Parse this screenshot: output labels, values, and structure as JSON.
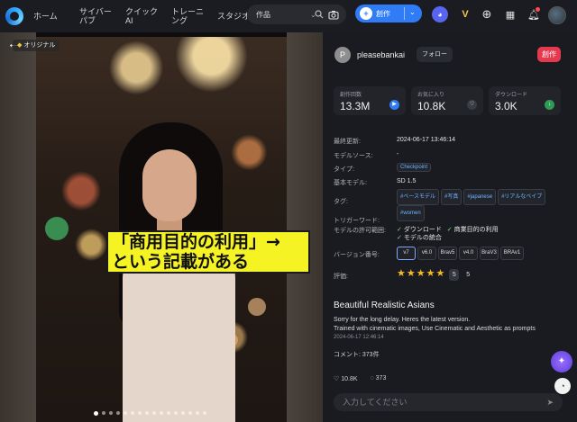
{
  "nav": {
    "items": [
      "ホーム",
      "サイバーパブ",
      "クイックAI",
      "トレーニング",
      "スタジオ"
    ],
    "search_select": "作品",
    "create_label": "創作"
  },
  "viewer": {
    "original_badge": "オリジナル",
    "slide_count": 16,
    "active_slide": 1
  },
  "annotation": {
    "line1": "「商用目的の利用」→",
    "line2": "という記載がある"
  },
  "user": {
    "initial": "P",
    "name": "pleasebankai",
    "follow_label": "フォロー",
    "create_label": "創作"
  },
  "stats": [
    {
      "label": "創作回数",
      "value": "13.3M"
    },
    {
      "label": "お気に入り",
      "value": "10.8K"
    },
    {
      "label": "ダウンロード",
      "value": "3.0K"
    }
  ],
  "details": {
    "updated_label": "最終更新:",
    "updated_value": "2024-06-17 13:46:14",
    "source_label": "モデルソース:",
    "source_value": "-",
    "type_label": "タイプ:",
    "type_value": "Checkpoint",
    "base_label": "基本モデル:",
    "base_value": "SD 1.5",
    "tags_label": "タグ:",
    "tags": [
      "#ベースモデル",
      "#写真",
      "#japanese",
      "#リアルなベイブ",
      "#women"
    ],
    "trigger_label": "トリガーワード:",
    "license_label": "モデルの許可範囲:",
    "licenses": [
      "ダウンロード",
      "商業目的の利用",
      "モデルの統合"
    ],
    "version_label": "バージョン番号:",
    "versions": [
      "v7",
      "v6.0",
      "Brav5",
      "v4.0",
      "BraV3",
      "BRAv1"
    ],
    "rating_label": "評価:",
    "rating_stars": "★★★★★",
    "rating_badge": "5",
    "rating_value": "5"
  },
  "model": {
    "title": "Beautiful Realistic Asians",
    "desc1": "Sorry for the long delay. Heres the latest version.",
    "desc2": "Trained with cinematic images, Use Cinematic and Aesthetic as prompts",
    "timestamp": "2024-06-17 12:46:14",
    "comments": "コメント: 373件",
    "likes": "10.8K",
    "comment_count": "373",
    "input_placeholder": "入力してください"
  },
  "colors": {
    "accent": "#2f7cf6",
    "create_red": "#e53950",
    "annotation_yellow": "#f6f325"
  }
}
